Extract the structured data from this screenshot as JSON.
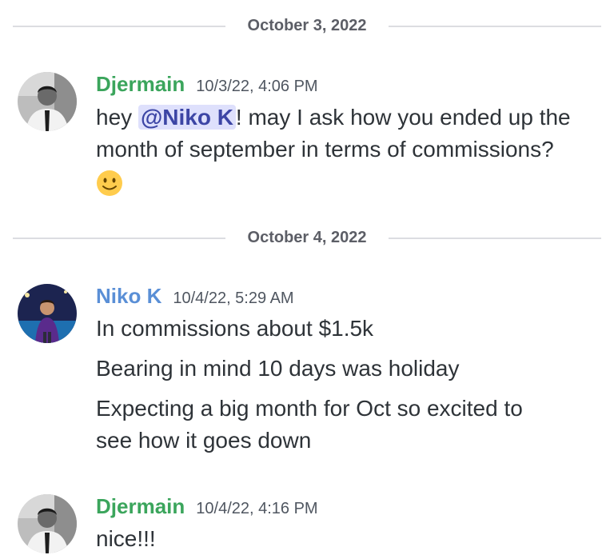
{
  "colors": {
    "djermain_name": "#3ba55c",
    "niko_name": "#5a8fd6",
    "mention_bg": "#dee0fc",
    "mention_text": "#3c45a5",
    "divider": "#dcdde1"
  },
  "dividers": [
    {
      "label": "October 3, 2022"
    },
    {
      "label": "October 4, 2022"
    }
  ],
  "messages": [
    {
      "username": "Djermain",
      "timestamp": "10/3/22, 4:06 PM",
      "line1_prefix": "hey",
      "mention": "@Niko K",
      "line1_suffix": "! may I ask how you ended up the",
      "line2": "month of september in terms of commissions?",
      "emoji": "slightly-smiling-face"
    },
    {
      "username": "Niko K",
      "timestamp": "10/4/22, 5:29 AM",
      "lines": [
        "In commissions about $1.5k",
        "Bearing in mind 10 days was holiday",
        "Expecting a big month for Oct so excited to",
        "see how it goes down"
      ]
    },
    {
      "username": "Djermain",
      "timestamp": "10/4/22, 4:16 PM",
      "text": "nice!!!"
    }
  ]
}
